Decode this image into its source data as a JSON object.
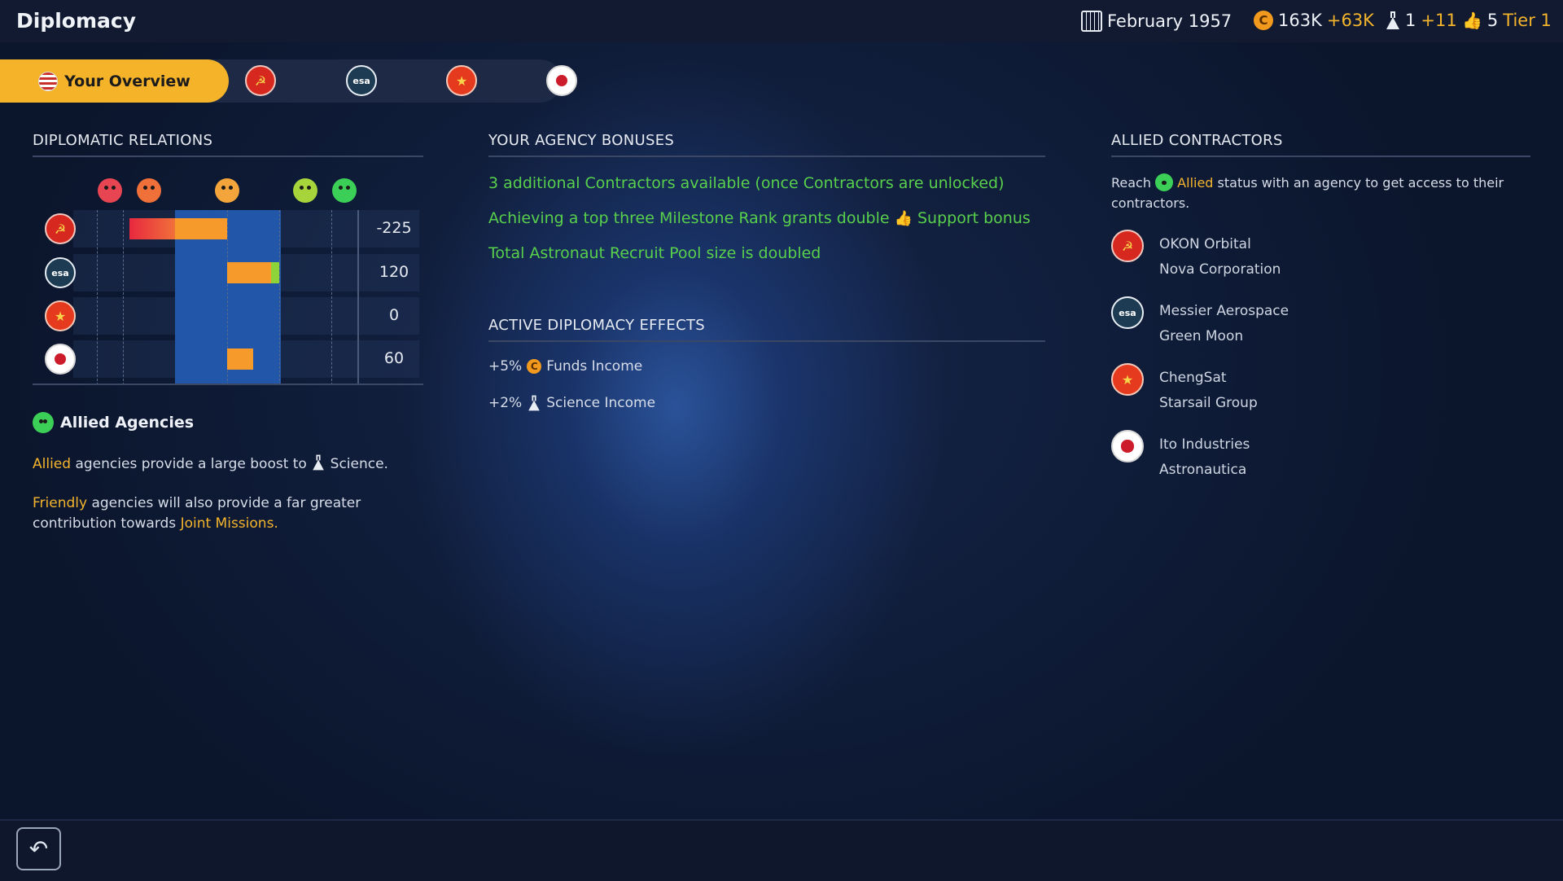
{
  "header": {
    "title": "Diplomacy",
    "date": "February 1957",
    "funds": "163K",
    "funds_delta": "+63K",
    "science": "1",
    "science_delta": "+11",
    "support": "5",
    "support_tier": "Tier 1"
  },
  "tabs": {
    "active_label": "Your Overview",
    "agencies": [
      "ussr",
      "esa",
      "china",
      "japan"
    ]
  },
  "relations": {
    "title": "DIPLOMATIC RELATIONS",
    "rows": [
      {
        "agency": "ussr",
        "value": "-225",
        "numeric": -225
      },
      {
        "agency": "esa",
        "value": "120",
        "numeric": 120
      },
      {
        "agency": "china",
        "value": "0",
        "numeric": 0
      },
      {
        "agency": "japan",
        "value": "60",
        "numeric": 60
      }
    ],
    "scale_min": -450,
    "scale_max": 250,
    "faces": [
      "hostile",
      "unfriendly",
      "neutral",
      "friendly",
      "allied"
    ],
    "allied_heading": "Allied Agencies",
    "allied_word": "Allied",
    "allied_text": "agencies provide a large boost to",
    "science_word": "Science.",
    "friendly_word": "Friendly",
    "friendly_text": "agencies will also provide a far greater contribution towards",
    "joint_missions": "Joint Missions."
  },
  "bonuses": {
    "title": "YOUR AGENCY BONUSES",
    "items": [
      "3 additional Contractors available (once Contractors are unlocked)",
      "Achieving a top three Milestone Rank grants double",
      "Total Astronaut Recruit Pool size is doubled"
    ],
    "support_bonus_suffix": "Support bonus"
  },
  "effects": {
    "title": "ACTIVE DIPLOMACY EFFECTS",
    "funds_pct": "+5%",
    "funds_label": "Funds Income",
    "science_pct": "+2%",
    "science_label": "Science Income"
  },
  "contractors": {
    "title": "ALLIED CONTRACTORS",
    "intro_prefix": "Reach",
    "intro_allied": "Allied",
    "intro_suffix": "status with an agency to get access to their",
    "intro_line2": "contractors.",
    "list": [
      {
        "agency": "ussr",
        "names": [
          "OKON Orbital",
          "Nova Corporation"
        ]
      },
      {
        "agency": "esa",
        "names": [
          "Messier Aerospace",
          "Green Moon"
        ]
      },
      {
        "agency": "china",
        "names": [
          "ChengSat",
          "Starsail Group"
        ]
      },
      {
        "agency": "japan",
        "names": [
          "Ito Industries",
          "Astronautica"
        ]
      }
    ]
  },
  "colors": {
    "accent": "#f5b32a",
    "bonus_green": "#58d04c",
    "neutral_band": "#2156a8"
  },
  "icons": {
    "calendar": "calendar-icon",
    "funds": "coin-icon",
    "science": "flask-icon",
    "support": "thumbs-up-icon",
    "back": "back-arrow-icon"
  }
}
